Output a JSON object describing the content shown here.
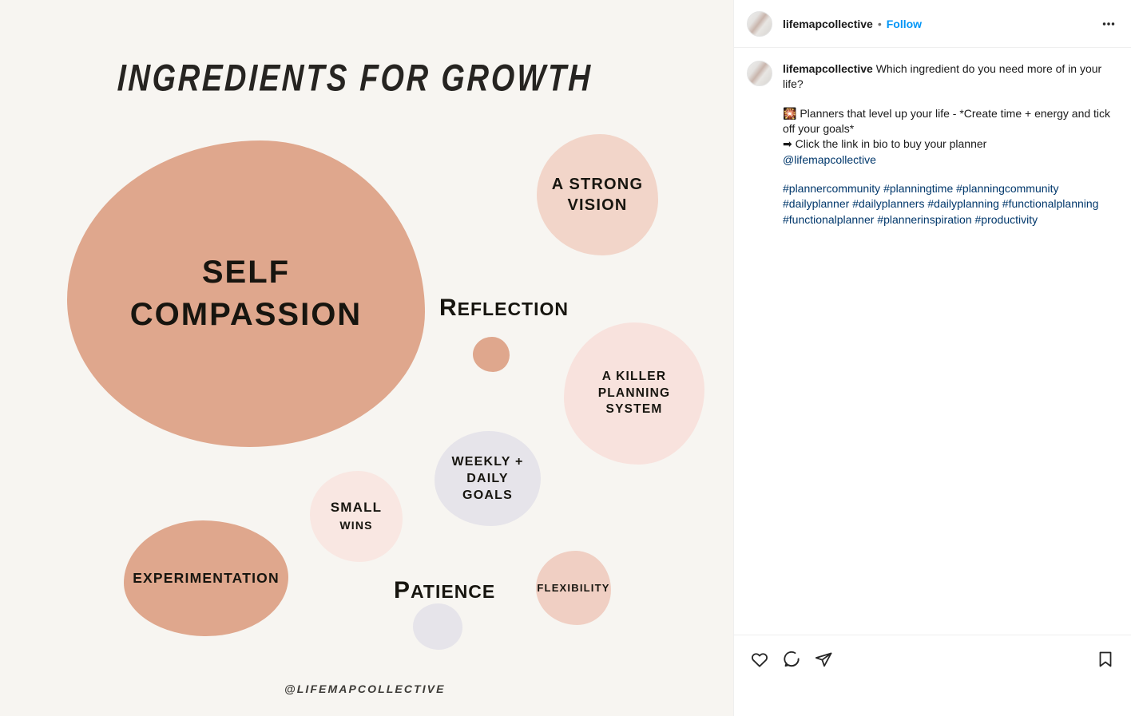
{
  "post": {
    "header": {
      "username": "lifemapcollective",
      "separator": "•",
      "follow_label": "Follow",
      "more_icon": "more-options-icon",
      "avatar_icon": "avatar"
    },
    "caption": {
      "username": "lifemapcollective",
      "line_1": "Which ingredient do you need more of in your life?",
      "line_2_emoji": "🎇",
      "line_2": "Planners that level up your life - *Create time + energy and tick off your goals*",
      "line_3": "➡ Click the link in bio to buy your planner",
      "mention": "@lifemapcollective",
      "hashtags": [
        "#plannercommunity",
        "#planningtime",
        "#planningcommunity",
        "#dailyplanner",
        "#dailyplanners",
        "#dailyplanning",
        "#functionalplanning",
        "#functionalplanner",
        "#plannerinspiration",
        "#productivity"
      ]
    },
    "actions": {
      "like": "like-icon",
      "comment": "comment-icon",
      "share": "share-icon",
      "save": "save-icon"
    }
  },
  "graphic": {
    "title": "INGREDIENTS FOR GROWTH",
    "watermark": "@LIFEMAPCOLLECTIVE",
    "background_color": "#f7f5f1",
    "blobs": [
      {
        "id": "self-compassion",
        "lines": [
          "SELF",
          "COMPASSION"
        ],
        "color": "#dfa78d"
      },
      {
        "id": "strong-vision",
        "lines": [
          "A STRONG",
          "VISION"
        ],
        "color": "#f2d5c9"
      },
      {
        "id": "killer-planning",
        "lines": [
          "A KILLER PLANNING",
          "SYSTEM"
        ],
        "color": "#f8e2dd"
      },
      {
        "id": "weekly-goals",
        "lines": [
          "WEEKLY +",
          "DAILY",
          "GOALS"
        ],
        "color": "#e6e4ea"
      },
      {
        "id": "small-wins",
        "lines": [
          "SMALL",
          "WINS"
        ],
        "color": "#f9e7e2"
      },
      {
        "id": "experimentation",
        "lines": [
          "EXPERIMENTATION"
        ],
        "color": "#dfa78d"
      },
      {
        "id": "flexibility",
        "lines": [
          "FLEXIBILITY"
        ],
        "color": "#f0cfc3"
      },
      {
        "id": "reflection-dot",
        "lines": [],
        "color": "#dfa78d"
      },
      {
        "id": "patience-dot",
        "lines": [],
        "color": "#e6e4ea"
      }
    ],
    "labels": [
      {
        "id": "reflection",
        "cap": "R",
        "rest": "EFLECTION"
      },
      {
        "id": "patience",
        "cap": "P",
        "rest": "ATIENCE"
      }
    ]
  }
}
